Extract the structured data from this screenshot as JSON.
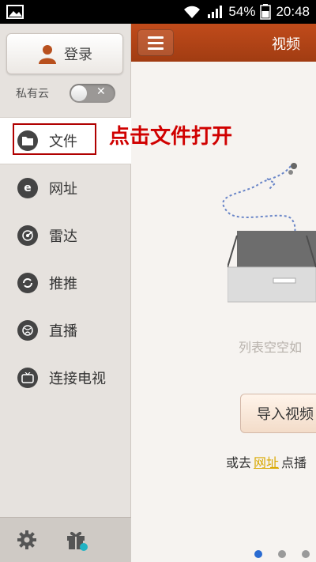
{
  "status_bar": {
    "battery": "54%",
    "time": "20:48"
  },
  "sidebar": {
    "login_label": "登录",
    "private_cloud_label": "私有云",
    "toggle_off_symbol": "✕",
    "items": [
      {
        "label": "文件",
        "icon": "folder-icon"
      },
      {
        "label": "网址",
        "icon": "browser-e-icon"
      },
      {
        "label": "雷达",
        "icon": "radar-icon"
      },
      {
        "label": "推推",
        "icon": "sync-icon"
      },
      {
        "label": "直播",
        "icon": "globe-icon"
      },
      {
        "label": "连接电视",
        "icon": "tv-icon"
      }
    ],
    "footer_icons": [
      "gear-icon",
      "gift-icon"
    ]
  },
  "annotation": {
    "instruction": "点击文件打开",
    "highlight_color": "#b00000"
  },
  "main": {
    "title": "视频",
    "empty_text": "列表空空如",
    "import_button": "导入视频",
    "hint_prefix": "或去",
    "hint_link": "网址",
    "hint_suffix": "点播"
  },
  "colors": {
    "accent": "#b2441a",
    "link": "#d9a800",
    "active_dot": "#2a6bd1"
  }
}
